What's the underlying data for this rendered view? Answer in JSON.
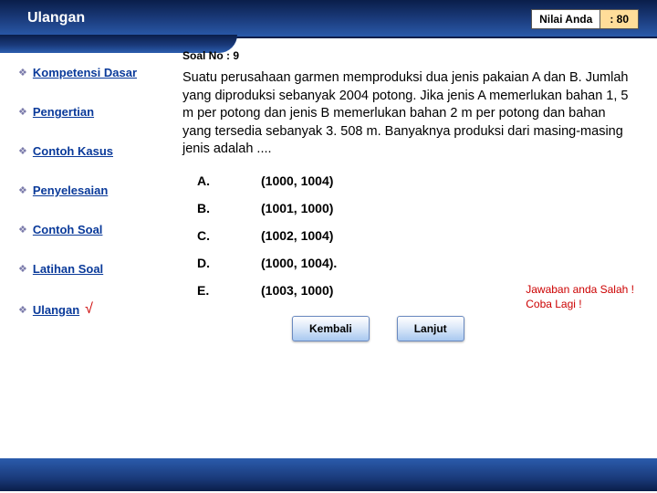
{
  "header": {
    "title": "Ulangan",
    "score_label": "Nilai Anda",
    "score_value": ": 80"
  },
  "sidebar": {
    "items": [
      {
        "label": "Kompetensi Dasar",
        "active": false
      },
      {
        "label": "Pengertian",
        "active": false
      },
      {
        "label": "Contoh Kasus",
        "active": false
      },
      {
        "label": "Penyelesaian",
        "active": false
      },
      {
        "label": "Contoh Soal",
        "active": false
      },
      {
        "label": "Latihan Soal",
        "active": false
      },
      {
        "label": "Ulangan",
        "active": true
      }
    ],
    "check_mark": "√"
  },
  "main": {
    "soal_no": "Soal No : 9",
    "question": "Suatu perusahaan garmen memproduksi dua jenis pakaian  A dan B. Jumlah yang diproduksi sebanyak 2004 potong. Jika jenis A memerlukan bahan 1, 5 m per potong dan jenis B memerlukan bahan 2 m per potong dan bahan yang tersedia sebanyak 3. 508 m. Banyaknya produksi  dari masing-masing jenis adalah ....",
    "options": [
      {
        "label": "A.",
        "value": "(1000, 1004)"
      },
      {
        "label": "B.",
        "value": "(1001, 1000)"
      },
      {
        "label": "C.",
        "value": "(1002, 1004)"
      },
      {
        "label": "D.",
        "value": "(1000, 1004)."
      },
      {
        "label": "E.",
        "value": "(1003, 1000)"
      }
    ],
    "feedback_line1": "Jawaban anda Salah !",
    "feedback_line2": "Coba Lagi !",
    "btn_back": "Kembali",
    "btn_next": "Lanjut"
  }
}
